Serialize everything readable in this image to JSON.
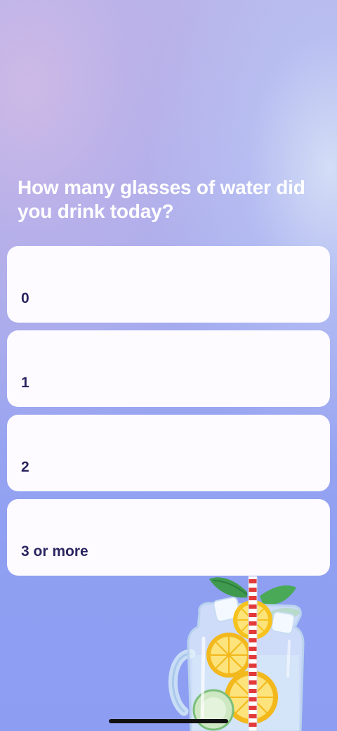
{
  "question": "How many glasses of water did you drink today?",
  "options": [
    {
      "label": "0"
    },
    {
      "label": "1"
    },
    {
      "label": "2"
    },
    {
      "label": "3 or more"
    }
  ],
  "illustration": {
    "icon": "lemon-water-jar-icon"
  },
  "colors": {
    "option_background": "#fdfbff",
    "option_text": "#2b2660",
    "question_text": "#ffffff"
  }
}
